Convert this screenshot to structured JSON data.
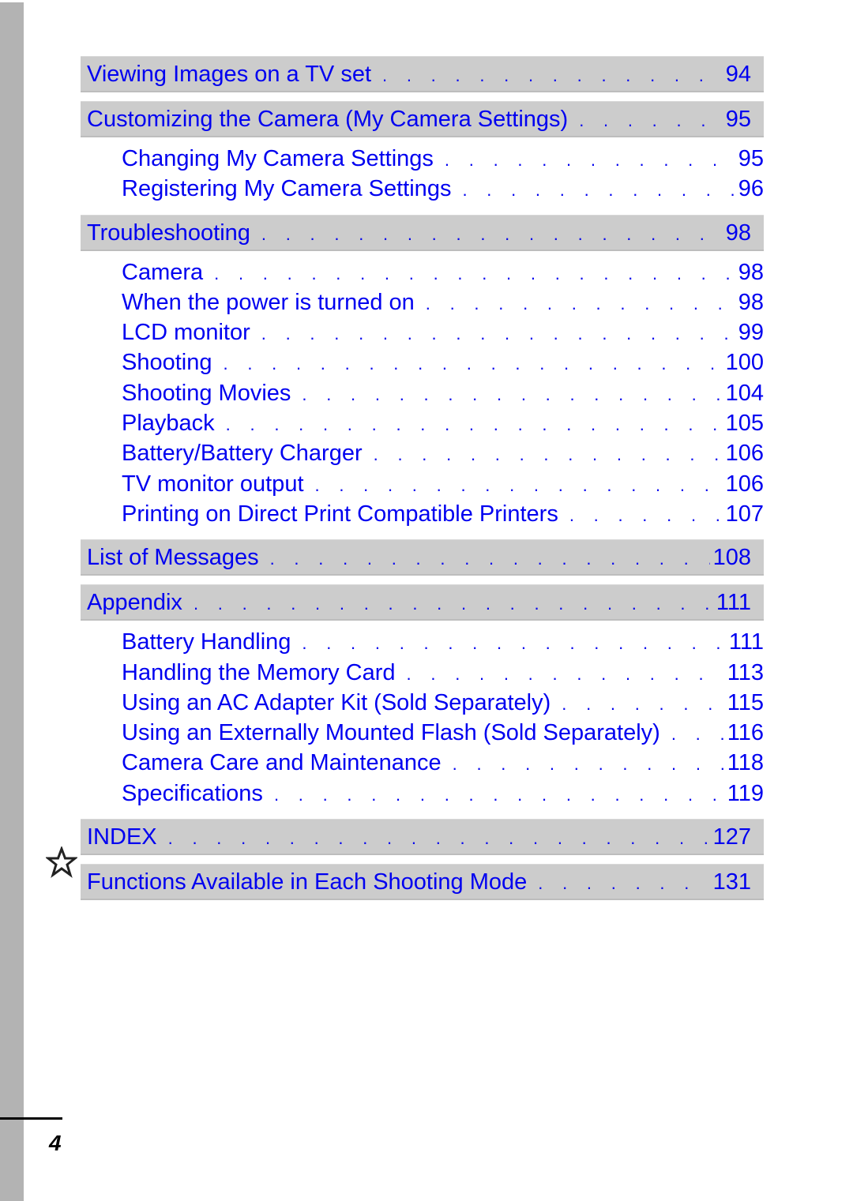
{
  "toc": {
    "sections": [
      {
        "title": "Viewing Images on a TV set",
        "page": "94",
        "items": []
      },
      {
        "title": "Customizing the Camera (My Camera Settings)",
        "page": "95",
        "items": [
          {
            "title": "Changing My Camera Settings",
            "page": "95"
          },
          {
            "title": "Registering My Camera Settings",
            "page": "96"
          }
        ]
      },
      {
        "title": "Troubleshooting",
        "page": "98",
        "items": [
          {
            "title": "Camera",
            "page": "98"
          },
          {
            "title": "When the power is turned on",
            "page": "98"
          },
          {
            "title": "LCD monitor",
            "page": "99"
          },
          {
            "title": "Shooting",
            "page": "100"
          },
          {
            "title": "Shooting Movies",
            "page": "104"
          },
          {
            "title": "Playback",
            "page": "105"
          },
          {
            "title": "Battery/Battery Charger",
            "page": "106"
          },
          {
            "title": "TV monitor output",
            "page": "106"
          },
          {
            "title": "Printing on Direct Print Compatible Printers",
            "page": "107"
          }
        ]
      },
      {
        "title": "List of Messages",
        "page": "108",
        "items": []
      },
      {
        "title": "Appendix",
        "page": "111",
        "items": [
          {
            "title": "Battery Handling",
            "page": "111"
          },
          {
            "title": "Handling the Memory Card",
            "page": "113"
          },
          {
            "title": "Using an AC Adapter Kit (Sold Separately)",
            "page": "115"
          },
          {
            "title": "Using an Externally Mounted Flash (Sold Separately)",
            "page": "116"
          },
          {
            "title": "Camera Care and Maintenance",
            "page": "118"
          },
          {
            "title": "Specifications",
            "page": "119"
          }
        ]
      },
      {
        "title": "INDEX",
        "page": "127",
        "items": []
      },
      {
        "title": "Functions Available in Each Shooting Mode",
        "page": "131",
        "items": [],
        "icon": "star-icon"
      }
    ]
  },
  "footer": {
    "page_number": "4"
  },
  "colors": {
    "link": "#0000f0",
    "bar": "#cccccc",
    "strip": "#b3b3b3"
  }
}
